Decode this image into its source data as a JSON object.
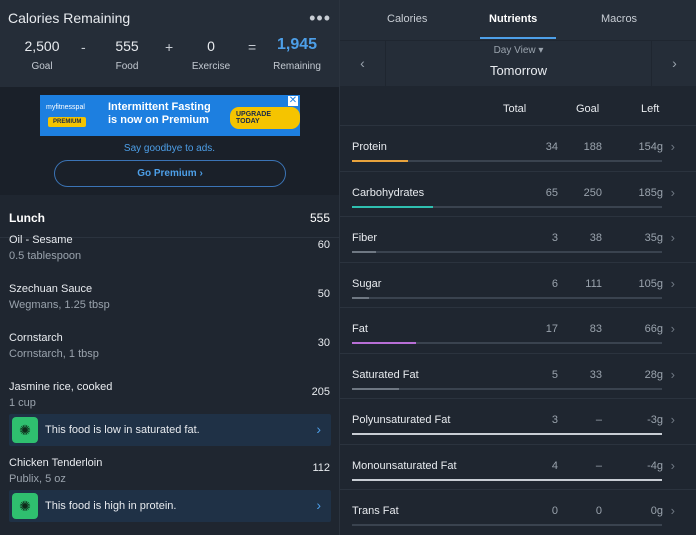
{
  "calories": {
    "title": "Calories Remaining",
    "goal": {
      "value": "2,500",
      "label": "Goal"
    },
    "food": {
      "value": "555",
      "label": "Food"
    },
    "exercise": {
      "value": "0",
      "label": "Exercise"
    },
    "remaining": {
      "value": "1,945",
      "label": "Remaining"
    },
    "op_minus": "-",
    "op_plus": "+",
    "op_equals": "="
  },
  "ad": {
    "brand": "myfitnesspal",
    "badge": "PREMIUM",
    "text": "Intermittent Fasting is now on Premium",
    "cta": "UPGRADE TODAY",
    "close": "✕",
    "bye": "Say goodbye to ads.",
    "premium_button": "Go Premium ›"
  },
  "lunch": {
    "title": "Lunch",
    "total": "555",
    "foods": [
      {
        "name": "Oil - Sesame",
        "desc": "0.5 tablespoon",
        "cal": "60"
      },
      {
        "name": "Szechuan Sauce",
        "desc": "Wegmans, 1.25 tbsp",
        "cal": "50"
      },
      {
        "name": "Cornstarch",
        "desc": "Cornstarch, 1 tbsp",
        "cal": "30"
      },
      {
        "name": "Jasmine rice, cooked",
        "desc": "1 cup",
        "cal": "205"
      },
      {
        "name": "Chicken Tenderloin",
        "desc": "Publix, 5 oz",
        "cal": "112"
      }
    ],
    "tips": [
      "This food is low in saturated fat.",
      "This food is high in protein."
    ]
  },
  "tabs": [
    "Calories",
    "Nutrients",
    "Macros"
  ],
  "active_tab": "Nutrients",
  "dayview": {
    "mode": "Day View ▾",
    "date": "Tomorrow"
  },
  "columns": {
    "total": "Total",
    "goal": "Goal",
    "left": "Left"
  },
  "nutrients": [
    {
      "name": "Protein",
      "total": "34",
      "goal": "188",
      "left": "154g",
      "progress": 0.181,
      "color": "#e8a33d"
    },
    {
      "name": "Carbohydrates",
      "total": "65",
      "goal": "250",
      "left": "185g",
      "progress": 0.26,
      "color": "#2fbfb0"
    },
    {
      "name": "Fiber",
      "total": "3",
      "goal": "38",
      "left": "35g",
      "progress": 0.079,
      "color": "#6f7883"
    },
    {
      "name": "Sugar",
      "total": "6",
      "goal": "111",
      "left": "105g",
      "progress": 0.054,
      "color": "#6f7883"
    },
    {
      "name": "Fat",
      "total": "17",
      "goal": "83",
      "left": "66g",
      "progress": 0.205,
      "color": "#b86fd6"
    },
    {
      "name": "Saturated Fat",
      "total": "5",
      "goal": "33",
      "left": "28g",
      "progress": 0.152,
      "color": "#6f7883"
    },
    {
      "name": "Polyunsaturated Fat",
      "total": "3",
      "goal": "–",
      "left": "-3g",
      "progress": 1.0,
      "color": "#c8cdd4"
    },
    {
      "name": "Monounsaturated Fat",
      "total": "4",
      "goal": "–",
      "left": "-4g",
      "progress": 1.0,
      "color": "#c8cdd4"
    },
    {
      "name": "Trans Fat",
      "total": "0",
      "goal": "0",
      "left": "0g",
      "progress": 0,
      "color": "#6f7883"
    }
  ]
}
